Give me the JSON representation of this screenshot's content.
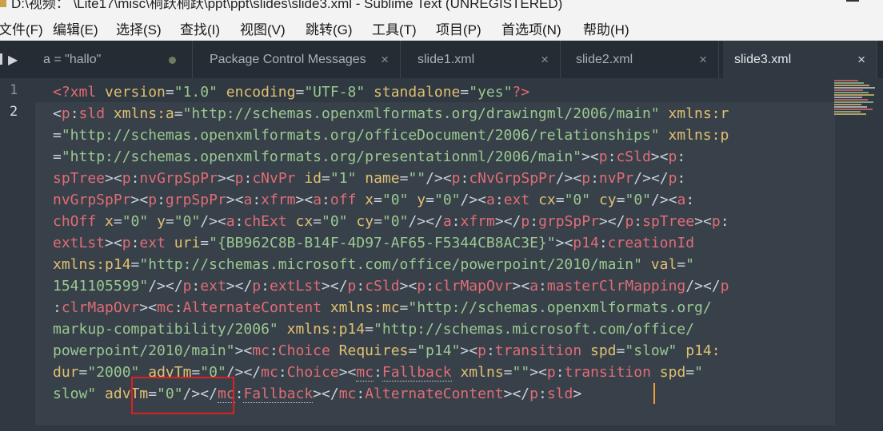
{
  "window": {
    "title": "D:\\视频：  \\Lite17\\misc\\桐跃桐跃\\ppt\\ppt\\slides\\slide3.xml - Sublime Text (UNREGISTERED)"
  },
  "menu": [
    {
      "label": "文件(F)"
    },
    {
      "label": "编辑(E)"
    },
    {
      "label": "选择(S)"
    },
    {
      "label": "查找(I)"
    },
    {
      "label": "视图(V)"
    },
    {
      "label": "跳转(G)"
    },
    {
      "label": "工具(T)"
    },
    {
      "label": "项目(P)"
    },
    {
      "label": "首选项(N)"
    },
    {
      "label": "帮助(H)"
    }
  ],
  "tabs": [
    {
      "label": "a =  \"hallo\"",
      "modified": true
    },
    {
      "label": "Package Control Messages",
      "close": "×"
    },
    {
      "label": "slide1.xml",
      "close": "×"
    },
    {
      "label": "slide2.xml",
      "close": "×"
    },
    {
      "label": "slide3.xml",
      "close": "×",
      "active": true
    }
  ],
  "editor": {
    "line_numbers": [
      "1",
      "2"
    ],
    "current_line": 2,
    "lines": [
      [
        {
          "t": "<?xml ",
          "c": "t"
        },
        {
          "t": "version",
          "c": "a"
        },
        {
          "t": "=",
          "c": "p"
        },
        {
          "t": "\"1.0\"",
          "c": "s"
        },
        {
          "t": " ",
          "c": "p"
        },
        {
          "t": "encoding",
          "c": "a"
        },
        {
          "t": "=",
          "c": "p"
        },
        {
          "t": "\"UTF-8\"",
          "c": "s"
        },
        {
          "t": " ",
          "c": "p"
        },
        {
          "t": "standalone",
          "c": "a"
        },
        {
          "t": "=",
          "c": "p"
        },
        {
          "t": "\"yes\"",
          "c": "s"
        },
        {
          "t": "?>",
          "c": "t"
        }
      ],
      [
        {
          "t": "<",
          "c": "p"
        },
        {
          "t": "p",
          "c": "t"
        },
        {
          "t": ":",
          "c": "p"
        },
        {
          "t": "sld",
          "c": "t"
        },
        {
          "t": " ",
          "c": "p"
        },
        {
          "t": "xmlns:a",
          "c": "a"
        },
        {
          "t": "=",
          "c": "p"
        },
        {
          "t": "\"http://schemas.openxmlformats.org/drawingml/2006/main\"",
          "c": "s"
        },
        {
          "t": " ",
          "c": "p"
        },
        {
          "t": "xmlns:r",
          "c": "a"
        }
      ],
      [
        {
          "t": "=",
          "c": "p"
        },
        {
          "t": "\"http://schemas.openxmlformats.org/officeDocument/2006/relationships\"",
          "c": "s"
        },
        {
          "t": " ",
          "c": "p"
        },
        {
          "t": "xmlns:p",
          "c": "a"
        }
      ],
      [
        {
          "t": "=",
          "c": "p"
        },
        {
          "t": "\"http://schemas.openxmlformats.org/presentationml/2006/main\"",
          "c": "s"
        },
        {
          "t": "><",
          "c": "p"
        },
        {
          "t": "p",
          "c": "t"
        },
        {
          "t": ":",
          "c": "p"
        },
        {
          "t": "cSld",
          "c": "t"
        },
        {
          "t": "><",
          "c": "p"
        },
        {
          "t": "p",
          "c": "t"
        },
        {
          "t": ":",
          "c": "p"
        }
      ],
      [
        {
          "t": "spTree",
          "c": "t"
        },
        {
          "t": "><",
          "c": "p"
        },
        {
          "t": "p",
          "c": "t"
        },
        {
          "t": ":",
          "c": "p"
        },
        {
          "t": "nvGrpSpPr",
          "c": "t"
        },
        {
          "t": "><",
          "c": "p"
        },
        {
          "t": "p",
          "c": "t"
        },
        {
          "t": ":",
          "c": "p"
        },
        {
          "t": "cNvPr",
          "c": "t"
        },
        {
          "t": " ",
          "c": "p"
        },
        {
          "t": "id",
          "c": "a"
        },
        {
          "t": "=",
          "c": "p"
        },
        {
          "t": "\"1\"",
          "c": "s"
        },
        {
          "t": " ",
          "c": "p"
        },
        {
          "t": "name",
          "c": "a"
        },
        {
          "t": "=",
          "c": "p"
        },
        {
          "t": "\"\"",
          "c": "s"
        },
        {
          "t": "/><",
          "c": "p"
        },
        {
          "t": "p",
          "c": "t"
        },
        {
          "t": ":",
          "c": "p"
        },
        {
          "t": "cNvGrpSpPr",
          "c": "t"
        },
        {
          "t": "/><",
          "c": "p"
        },
        {
          "t": "p",
          "c": "t"
        },
        {
          "t": ":",
          "c": "p"
        },
        {
          "t": "nvPr",
          "c": "t"
        },
        {
          "t": "/></",
          "c": "p"
        },
        {
          "t": "p",
          "c": "t"
        },
        {
          "t": ":",
          "c": "p"
        }
      ],
      [
        {
          "t": "nvGrpSpPr",
          "c": "t"
        },
        {
          "t": "><",
          "c": "p"
        },
        {
          "t": "p",
          "c": "t"
        },
        {
          "t": ":",
          "c": "p"
        },
        {
          "t": "grpSpPr",
          "c": "t"
        },
        {
          "t": "><",
          "c": "p"
        },
        {
          "t": "a",
          "c": "t"
        },
        {
          "t": ":",
          "c": "p"
        },
        {
          "t": "xfrm",
          "c": "t"
        },
        {
          "t": "><",
          "c": "p"
        },
        {
          "t": "a",
          "c": "t"
        },
        {
          "t": ":",
          "c": "p"
        },
        {
          "t": "off",
          "c": "t"
        },
        {
          "t": " ",
          "c": "p"
        },
        {
          "t": "x",
          "c": "a"
        },
        {
          "t": "=",
          "c": "p"
        },
        {
          "t": "\"0\"",
          "c": "s"
        },
        {
          "t": " ",
          "c": "p"
        },
        {
          "t": "y",
          "c": "a"
        },
        {
          "t": "=",
          "c": "p"
        },
        {
          "t": "\"0\"",
          "c": "s"
        },
        {
          "t": "/><",
          "c": "p"
        },
        {
          "t": "a",
          "c": "t"
        },
        {
          "t": ":",
          "c": "p"
        },
        {
          "t": "ext",
          "c": "t"
        },
        {
          "t": " ",
          "c": "p"
        },
        {
          "t": "cx",
          "c": "a"
        },
        {
          "t": "=",
          "c": "p"
        },
        {
          "t": "\"0\"",
          "c": "s"
        },
        {
          "t": " ",
          "c": "p"
        },
        {
          "t": "cy",
          "c": "a"
        },
        {
          "t": "=",
          "c": "p"
        },
        {
          "t": "\"0\"",
          "c": "s"
        },
        {
          "t": "/><",
          "c": "p"
        },
        {
          "t": "a",
          "c": "t"
        },
        {
          "t": ":",
          "c": "p"
        }
      ],
      [
        {
          "t": "chOff",
          "c": "t"
        },
        {
          "t": " ",
          "c": "p"
        },
        {
          "t": "x",
          "c": "a"
        },
        {
          "t": "=",
          "c": "p"
        },
        {
          "t": "\"0\"",
          "c": "s"
        },
        {
          "t": " ",
          "c": "p"
        },
        {
          "t": "y",
          "c": "a"
        },
        {
          "t": "=",
          "c": "p"
        },
        {
          "t": "\"0\"",
          "c": "s"
        },
        {
          "t": "/><",
          "c": "p"
        },
        {
          "t": "a",
          "c": "t"
        },
        {
          "t": ":",
          "c": "p"
        },
        {
          "t": "chExt",
          "c": "t"
        },
        {
          "t": " ",
          "c": "p"
        },
        {
          "t": "cx",
          "c": "a"
        },
        {
          "t": "=",
          "c": "p"
        },
        {
          "t": "\"0\"",
          "c": "s"
        },
        {
          "t": " ",
          "c": "p"
        },
        {
          "t": "cy",
          "c": "a"
        },
        {
          "t": "=",
          "c": "p"
        },
        {
          "t": "\"0\"",
          "c": "s"
        },
        {
          "t": "/></",
          "c": "p"
        },
        {
          "t": "a",
          "c": "t"
        },
        {
          "t": ":",
          "c": "p"
        },
        {
          "t": "xfrm",
          "c": "t"
        },
        {
          "t": "></",
          "c": "p"
        },
        {
          "t": "p",
          "c": "t"
        },
        {
          "t": ":",
          "c": "p"
        },
        {
          "t": "grpSpPr",
          "c": "t"
        },
        {
          "t": "></",
          "c": "p"
        },
        {
          "t": "p",
          "c": "t"
        },
        {
          "t": ":",
          "c": "p"
        },
        {
          "t": "spTree",
          "c": "t"
        },
        {
          "t": "><",
          "c": "p"
        },
        {
          "t": "p",
          "c": "t"
        },
        {
          "t": ":",
          "c": "p"
        }
      ],
      [
        {
          "t": "extLst",
          "c": "t"
        },
        {
          "t": "><",
          "c": "p"
        },
        {
          "t": "p",
          "c": "t"
        },
        {
          "t": ":",
          "c": "p"
        },
        {
          "t": "ext",
          "c": "t"
        },
        {
          "t": " ",
          "c": "p"
        },
        {
          "t": "uri",
          "c": "a"
        },
        {
          "t": "=",
          "c": "p"
        },
        {
          "t": "\"{BB962C8B-B14F-4D97-AF65-F5344CB8AC3E}\"",
          "c": "s"
        },
        {
          "t": "><",
          "c": "p"
        },
        {
          "t": "p14",
          "c": "t"
        },
        {
          "t": ":",
          "c": "p"
        },
        {
          "t": "creationId",
          "c": "t"
        }
      ],
      [
        {
          "t": "xmlns:p14",
          "c": "a"
        },
        {
          "t": "=",
          "c": "p"
        },
        {
          "t": "\"http://schemas.microsoft.com/office/powerpoint/2010/main\"",
          "c": "s"
        },
        {
          "t": " ",
          "c": "p"
        },
        {
          "t": "val",
          "c": "a"
        },
        {
          "t": "=",
          "c": "p"
        },
        {
          "t": "\"",
          "c": "s"
        }
      ],
      [
        {
          "t": "1541105599\"",
          "c": "s"
        },
        {
          "t": "/></",
          "c": "p"
        },
        {
          "t": "p",
          "c": "t"
        },
        {
          "t": ":",
          "c": "p"
        },
        {
          "t": "ext",
          "c": "t"
        },
        {
          "t": "></",
          "c": "p"
        },
        {
          "t": "p",
          "c": "t"
        },
        {
          "t": ":",
          "c": "p"
        },
        {
          "t": "extLst",
          "c": "t"
        },
        {
          "t": "></",
          "c": "p"
        },
        {
          "t": "p",
          "c": "t"
        },
        {
          "t": ":",
          "c": "p"
        },
        {
          "t": "cSld",
          "c": "t"
        },
        {
          "t": "><",
          "c": "p"
        },
        {
          "t": "p",
          "c": "t"
        },
        {
          "t": ":",
          "c": "p"
        },
        {
          "t": "clrMapOvr",
          "c": "t"
        },
        {
          "t": "><",
          "c": "p"
        },
        {
          "t": "a",
          "c": "t"
        },
        {
          "t": ":",
          "c": "p"
        },
        {
          "t": "masterClrMapping",
          "c": "t"
        },
        {
          "t": "/></",
          "c": "p"
        },
        {
          "t": "p",
          "c": "t"
        }
      ],
      [
        {
          "t": ":",
          "c": "p"
        },
        {
          "t": "clrMapOvr",
          "c": "t"
        },
        {
          "t": "><",
          "c": "p"
        },
        {
          "t": "mc",
          "c": "t"
        },
        {
          "t": ":",
          "c": "p"
        },
        {
          "t": "AlternateContent",
          "c": "t"
        },
        {
          "t": " ",
          "c": "p"
        },
        {
          "t": "xmlns:mc",
          "c": "a"
        },
        {
          "t": "=",
          "c": "p"
        },
        {
          "t": "\"http://schemas.openxmlformats.org/",
          "c": "s"
        }
      ],
      [
        {
          "t": "markup-compatibility/2006\"",
          "c": "s"
        },
        {
          "t": " ",
          "c": "p"
        },
        {
          "t": "xmlns:p14",
          "c": "a"
        },
        {
          "t": "=",
          "c": "p"
        },
        {
          "t": "\"http://schemas.microsoft.com/office/",
          "c": "s"
        }
      ],
      [
        {
          "t": "powerpoint/2010/main\"",
          "c": "s"
        },
        {
          "t": "><",
          "c": "p"
        },
        {
          "t": "mc",
          "c": "t"
        },
        {
          "t": ":",
          "c": "p"
        },
        {
          "t": "Choice",
          "c": "t"
        },
        {
          "t": " ",
          "c": "p"
        },
        {
          "t": "Requires",
          "c": "a"
        },
        {
          "t": "=",
          "c": "p"
        },
        {
          "t": "\"p14\"",
          "c": "s"
        },
        {
          "t": "><",
          "c": "p"
        },
        {
          "t": "p",
          "c": "t"
        },
        {
          "t": ":",
          "c": "p"
        },
        {
          "t": "transition",
          "c": "t"
        },
        {
          "t": " ",
          "c": "p"
        },
        {
          "t": "spd",
          "c": "a"
        },
        {
          "t": "=",
          "c": "p"
        },
        {
          "t": "\"slow\"",
          "c": "s"
        },
        {
          "t": " ",
          "c": "p"
        },
        {
          "t": "p14:",
          "c": "a"
        }
      ],
      [
        {
          "t": "dur",
          "c": "a"
        },
        {
          "t": "=",
          "c": "p"
        },
        {
          "t": "\"2000\"",
          "c": "s"
        },
        {
          "t": " ",
          "c": "p"
        },
        {
          "t": "advTm",
          "c": "a"
        },
        {
          "t": "=",
          "c": "p"
        },
        {
          "t": "\"0\"",
          "c": "s"
        },
        {
          "t": "/></",
          "c": "p"
        },
        {
          "t": "mc",
          "c": "t"
        },
        {
          "t": ":",
          "c": "p"
        },
        {
          "t": "Choice",
          "c": "t"
        },
        {
          "t": "><",
          "c": "p"
        },
        {
          "t": "mc",
          "c": "t",
          "u": true
        },
        {
          "t": ":",
          "c": "p"
        },
        {
          "t": "Fallback",
          "c": "t",
          "u": true
        },
        {
          "t": " ",
          "c": "p"
        },
        {
          "t": "xmlns",
          "c": "a"
        },
        {
          "t": "=",
          "c": "p"
        },
        {
          "t": "\"\"",
          "c": "s"
        },
        {
          "t": "><",
          "c": "p"
        },
        {
          "t": "p",
          "c": "t"
        },
        {
          "t": ":",
          "c": "p"
        },
        {
          "t": "transition",
          "c": "t"
        },
        {
          "t": " ",
          "c": "p"
        },
        {
          "t": "spd",
          "c": "a"
        },
        {
          "t": "=",
          "c": "p"
        },
        {
          "t": "\"",
          "c": "s"
        }
      ],
      [
        {
          "t": "slow\"",
          "c": "s"
        },
        {
          "t": " ",
          "c": "p"
        },
        {
          "t": "advTm",
          "c": "a"
        },
        {
          "t": "=",
          "c": "p"
        },
        {
          "t": "\"0\"",
          "c": "s"
        },
        {
          "t": "/></",
          "c": "p"
        },
        {
          "t": "mc",
          "c": "t",
          "u": true
        },
        {
          "t": ":",
          "c": "p"
        },
        {
          "t": "Fallback",
          "c": "t",
          "u": true
        },
        {
          "t": "></",
          "c": "p"
        },
        {
          "t": "mc",
          "c": "t"
        },
        {
          "t": ":",
          "c": "p"
        },
        {
          "t": "AlternateContent",
          "c": "t"
        },
        {
          "t": "></",
          "c": "p"
        },
        {
          "t": "p",
          "c": "t"
        },
        {
          "t": ":",
          "c": "p"
        },
        {
          "t": "sld",
          "c": "t"
        },
        {
          "t": ">",
          "c": "p"
        }
      ]
    ]
  },
  "colors": {
    "editor_bg": "#303841",
    "tag": "#e06c75",
    "attribute": "#e0c070",
    "string": "#9ac890",
    "punctuation": "#c8d0d8",
    "cursor": "#f0a030",
    "highlight_box": "#e02020"
  },
  "icons": {
    "nav": "sidebar-toggle-icon",
    "modified": "unsaved-dot-icon",
    "close": "close-icon"
  }
}
